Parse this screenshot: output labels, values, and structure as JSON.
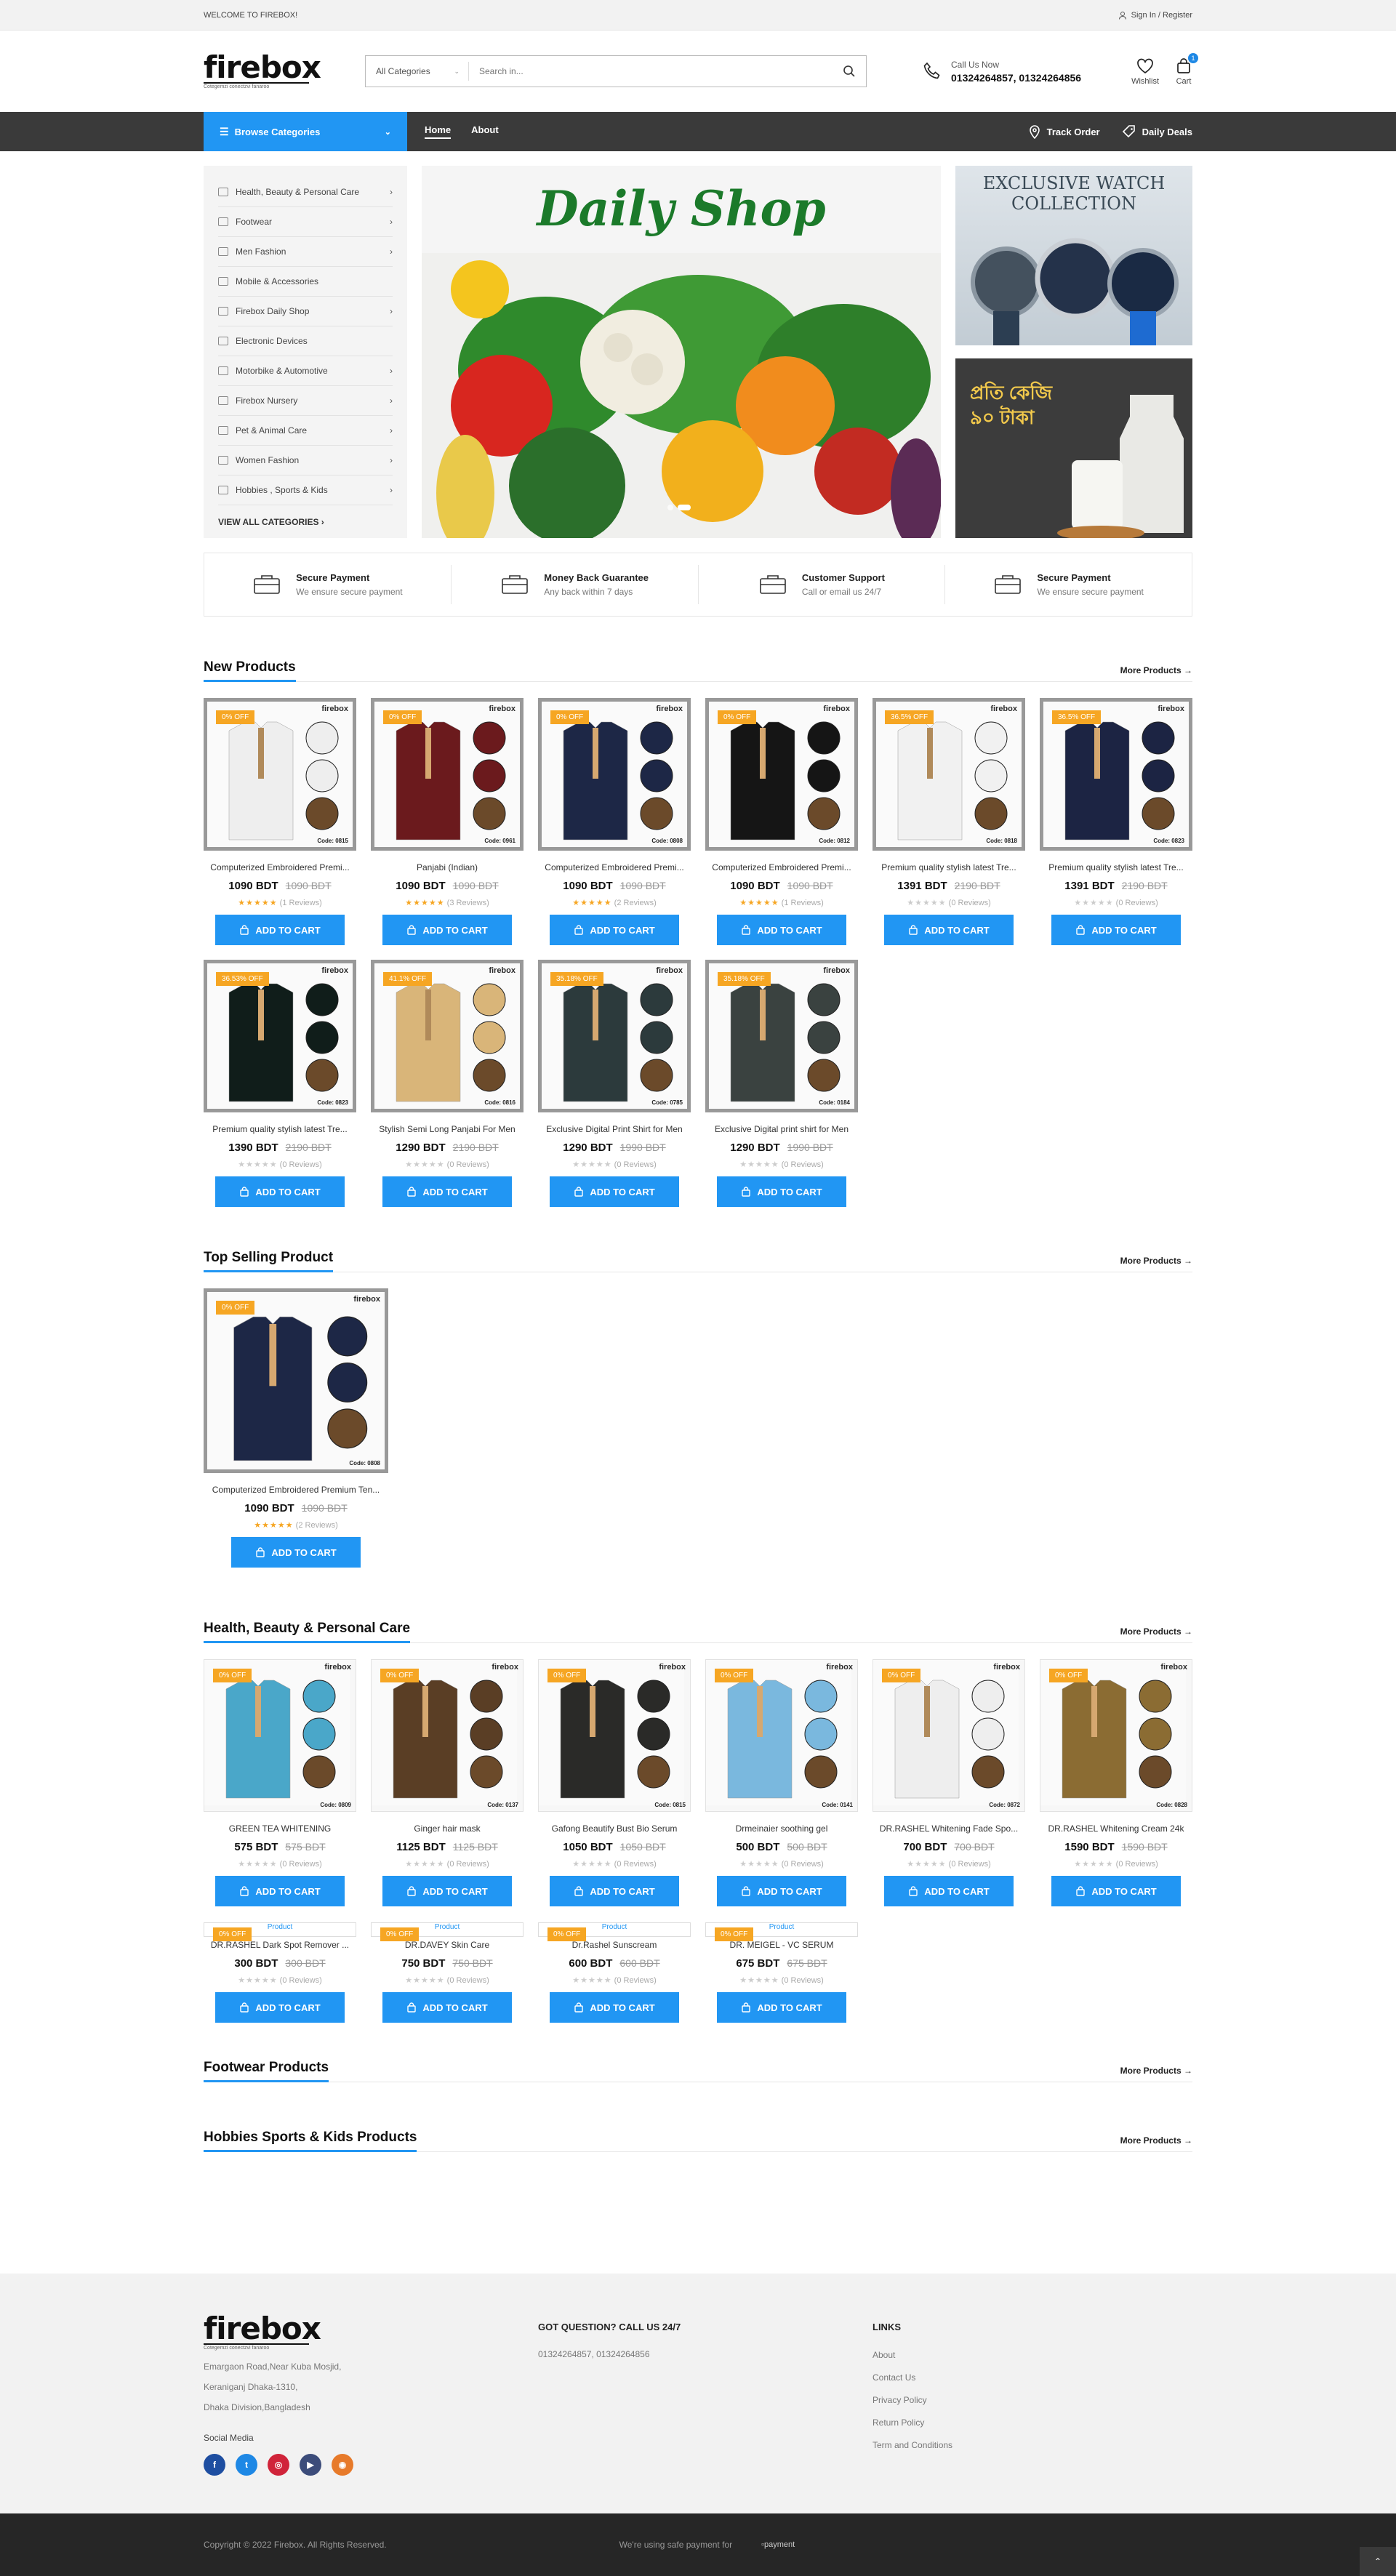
{
  "topbar": {
    "welcome": "WELCOME TO FIREBOX!",
    "signin": "Sign In / Register"
  },
  "header": {
    "logo": "firebox",
    "logo_tag": "Cotegemzi conectzvi fanaroo",
    "search_category": "All Categories",
    "search_placeholder": "Search in...",
    "call_label": "Call Us Now",
    "call_numbers": "01324264857, 01324264856",
    "wishlist": "Wishlist",
    "cart": "Cart",
    "cart_count": "1"
  },
  "nav": {
    "browse": "Browse Categories",
    "links": [
      "Home",
      "About"
    ],
    "track": "Track Order",
    "deals": "Daily Deals"
  },
  "categories": [
    {
      "label": "Health, Beauty & Personal Care",
      "arrow": "›"
    },
    {
      "label": "Footwear",
      "arrow": "›"
    },
    {
      "label": "Men Fashion",
      "arrow": "›"
    },
    {
      "label": "Mobile & Accessories",
      "arrow": ""
    },
    {
      "label": "Firebox Daily Shop",
      "arrow": "›"
    },
    {
      "label": "Electronic Devices",
      "arrow": ""
    },
    {
      "label": "Motorbike & Automotive",
      "arrow": "›"
    },
    {
      "label": "Firebox Nursery",
      "arrow": "›"
    },
    {
      "label": "Pet & Animal Care",
      "arrow": "›"
    },
    {
      "label": "Women Fashion",
      "arrow": "›"
    },
    {
      "label": "Hobbies , Sports & Kids",
      "arrow": "›"
    }
  ],
  "view_all": "VIEW ALL CATEGORIES",
  "slider_title": "Daily Shop",
  "banner1": "EXCLUSIVE WATCH COLLECTION",
  "banner2": "প্রতি কেজি ৯০ টাকা",
  "features": [
    {
      "title": "Secure Payment",
      "sub": "We ensure secure payment"
    },
    {
      "title": "Money Back Guarantee",
      "sub": "Any back within 7 days"
    },
    {
      "title": "Customer Support",
      "sub": "Call or email us 24/7"
    },
    {
      "title": "Secure Payment",
      "sub": "We ensure secure payment"
    }
  ],
  "more_products": "More Products",
  "add_to_cart": "ADD TO CART",
  "sections": {
    "new": "New Products",
    "top": "Top Selling Product",
    "health": "Health, Beauty & Personal Care",
    "footwear": "Footwear Products",
    "hobbies": "Hobbies Sports & Kids Products"
  },
  "brand": "firebox",
  "new_products": [
    {
      "name": "Computerized Embroidered Premi...",
      "price": "1090 BDT",
      "old": "1090 BDT",
      "off": "0% OFF",
      "reviews": "(1 Reviews)",
      "rating": 5,
      "code": "Code: 0815",
      "color": "#eeeeee"
    },
    {
      "name": "Panjabi (Indian)",
      "price": "1090 BDT",
      "old": "1090 BDT",
      "off": "0% OFF",
      "reviews": "(3 Reviews)",
      "rating": 5,
      "code": "Code: 0961",
      "color": "#6b1a1d"
    },
    {
      "name": "Computerized Embroidered Premi...",
      "price": "1090 BDT",
      "old": "1090 BDT",
      "off": "0% OFF",
      "reviews": "(2 Reviews)",
      "rating": 5,
      "code": "Code: 0808",
      "color": "#1d2746"
    },
    {
      "name": "Computerized Embroidered Premi...",
      "price": "1090 BDT",
      "old": "1090 BDT",
      "off": "0% OFF",
      "reviews": "(1 Reviews)",
      "rating": 5,
      "code": "Code: 0812",
      "color": "#151515"
    },
    {
      "name": "Premium quality stylish latest Tre...",
      "price": "1391 BDT",
      "old": "2190 BDT",
      "off": "36.5% OFF",
      "reviews": "(0 Reviews)",
      "rating": 0,
      "code": "Code: 0818",
      "color": "#f1f1f1"
    },
    {
      "name": "Premium quality stylish latest Tre...",
      "price": "1391 BDT",
      "old": "2190 BDT",
      "off": "36.5% OFF",
      "reviews": "(0 Reviews)",
      "rating": 0,
      "code": "Code: 0823",
      "color": "#1c2443"
    },
    {
      "name": "Premium quality stylish latest Tre...",
      "price": "1390 BDT",
      "old": "2190 BDT",
      "off": "36.53% OFF",
      "reviews": "(0 Reviews)",
      "rating": 0,
      "code": "Code: 0823",
      "color": "#101d1a"
    },
    {
      "name": "Stylish Semi Long Panjabi For Men",
      "price": "1290 BDT",
      "old": "2190 BDT",
      "off": "41.1% OFF",
      "reviews": "(0 Reviews)",
      "rating": 0,
      "code": "Code: 0816",
      "color": "#d9b579"
    },
    {
      "name": "Exclusive Digital Print Shirt for Men",
      "price": "1290 BDT",
      "old": "1990 BDT",
      "off": "35.18% OFF",
      "reviews": "(0 Reviews)",
      "rating": 0,
      "code": "Code: 0785",
      "color": "#2c3a3c"
    },
    {
      "name": "Exclusive Digital print shirt for Men",
      "price": "1290 BDT",
      "old": "1990 BDT",
      "off": "35.18% OFF",
      "reviews": "(0 Reviews)",
      "rating": 0,
      "code": "Code: 0184",
      "color": "#3a4240"
    }
  ],
  "top_products": [
    {
      "name": "Computerized Embroidered Premium Ten...",
      "price": "1090 BDT",
      "old": "1090 BDT",
      "off": "0% OFF",
      "reviews": "(2 Reviews)",
      "rating": 5,
      "code": "Code: 0808",
      "color": "#1d2746"
    }
  ],
  "health_products": [
    {
      "name": "GREEN TEA WHITENING",
      "price": "575 BDT",
      "old": "575 BDT",
      "off": "0% OFF",
      "reviews": "(0 Reviews)",
      "rating": 0,
      "code": "Code: 0809",
      "color": "#4aa7c9"
    },
    {
      "name": "Ginger hair mask",
      "price": "1125 BDT",
      "old": "1125 BDT",
      "off": "0% OFF",
      "reviews": "(0 Reviews)",
      "rating": 0,
      "code": "Code: 0137",
      "color": "#5a3e25"
    },
    {
      "name": "Gafong Beautify Bust Bio Serum",
      "price": "1050 BDT",
      "old": "1050 BDT",
      "off": "0% OFF",
      "reviews": "(0 Reviews)",
      "rating": 0,
      "code": "Code: 0815",
      "color": "#2a2a28"
    },
    {
      "name": "Drmeinaier soothing gel",
      "price": "500 BDT",
      "old": "500 BDT",
      "off": "0% OFF",
      "reviews": "(0 Reviews)",
      "rating": 0,
      "code": "Code: 0141",
      "color": "#7ab8de"
    },
    {
      "name": "DR.RASHEL Whitening Fade Spo...",
      "price": "700 BDT",
      "old": "700 BDT",
      "off": "0% OFF",
      "reviews": "(0 Reviews)",
      "rating": 0,
      "code": "Code: 0872",
      "color": "#eeeeee"
    },
    {
      "name": "DR.RASHEL Whitening Cream 24k",
      "price": "1590 BDT",
      "old": "1590 BDT",
      "off": "0% OFF",
      "reviews": "(0 Reviews)",
      "rating": 0,
      "code": "Code: 0828",
      "color": "#8b6c33"
    }
  ],
  "health_products2": [
    {
      "name": "DR.RASHEL Dark Spot Remover ...",
      "price": "300 BDT",
      "old": "300 BDT",
      "off": "0% OFF",
      "reviews": "(0 Reviews)",
      "rating": 0
    },
    {
      "name": "DR.DAVEY Skin Care",
      "price": "750 BDT",
      "old": "750 BDT",
      "off": "0% OFF",
      "reviews": "(0 Reviews)",
      "rating": 0
    },
    {
      "name": "Dr.Rashel Sunscream",
      "price": "600 BDT",
      "old": "600 BDT",
      "off": "0% OFF",
      "reviews": "(0 Reviews)",
      "rating": 0
    },
    {
      "name": "DR. MEIGEL - VC SERUM",
      "price": "675 BDT",
      "old": "675 BDT",
      "off": "0% OFF",
      "reviews": "(0 Reviews)",
      "rating": 0
    }
  ],
  "broken_img_alt": "Product",
  "footer": {
    "logo": "firebox",
    "address": [
      "Emargaon Road,Near Kuba Mosjid,",
      "Keraniganj Dhaka-1310,",
      "Dhaka Division,Bangladesh"
    ],
    "social_label": "Social Media",
    "question": "GOT QUESTION? CALL US 24/7",
    "phones": "01324264857, 01324264856",
    "links_title": "LINKS",
    "links": [
      "About",
      "Contact Us",
      "Privacy Policy",
      "Return Policy",
      "Term and Conditions"
    ],
    "copyright": "Copyright © 2022 Firebox. All Rights Reserved.",
    "safe_payment": "We're using safe payment for",
    "payment_alt": "payment"
  }
}
